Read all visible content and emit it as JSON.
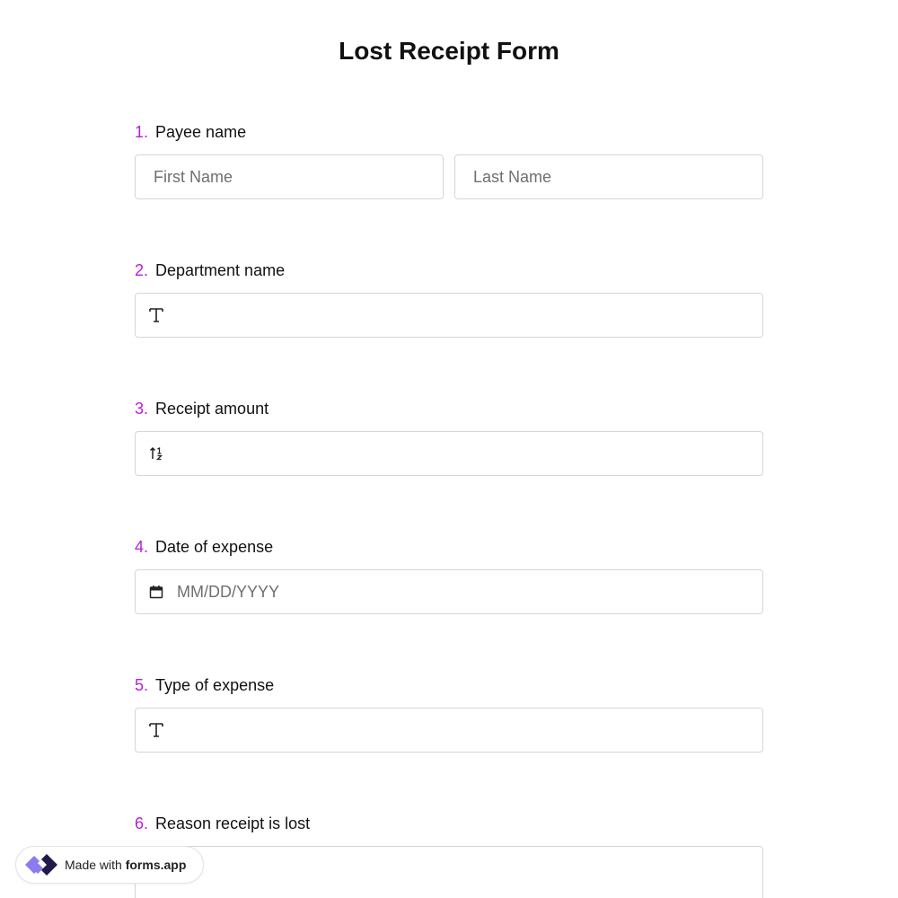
{
  "form": {
    "title": "Lost Receipt Form"
  },
  "questions": [
    {
      "number": "1.",
      "label": "Payee name",
      "first_placeholder": "First Name",
      "last_placeholder": "Last Name"
    },
    {
      "number": "2.",
      "label": "Department name",
      "icon": "text-icon"
    },
    {
      "number": "3.",
      "label": "Receipt amount",
      "icon": "number-icon"
    },
    {
      "number": "4.",
      "label": "Date of expense",
      "icon": "calendar-icon",
      "placeholder": "MM/DD/YYYY"
    },
    {
      "number": "5.",
      "label": "Type of expense",
      "icon": "text-icon"
    },
    {
      "number": "6.",
      "label": "Reason receipt is lost"
    }
  ],
  "badge": {
    "prefix": "Made with",
    "brand": "forms.app",
    "icon": "forms-app-logo"
  },
  "colors": {
    "accent": "#b81ed6",
    "border": "#d6d6d6",
    "logo_light": "#8b7bf0",
    "logo_dark": "#1f1b4b"
  }
}
